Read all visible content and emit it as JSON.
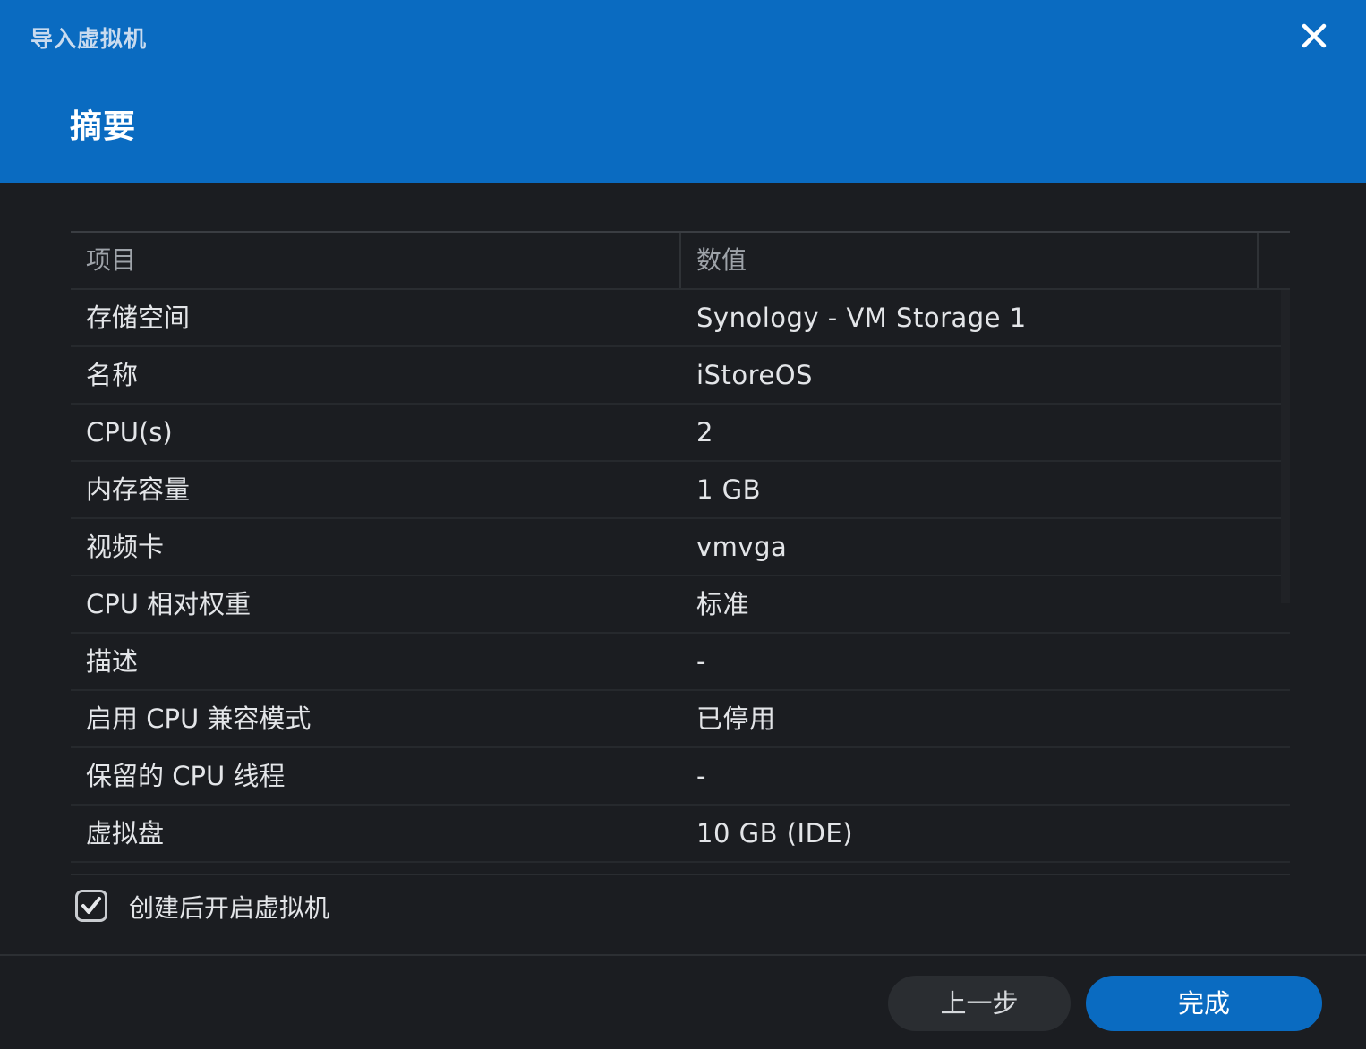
{
  "dialog": {
    "window_title": "导入虚拟机",
    "page_title": "摘要"
  },
  "table": {
    "headers": {
      "item": "项目",
      "value": "数值"
    },
    "rows": [
      {
        "item": "存储空间",
        "value": "Synology - VM Storage 1"
      },
      {
        "item": "名称",
        "value": "iStoreOS"
      },
      {
        "item": "CPU(s)",
        "value": "2"
      },
      {
        "item": "内存容量",
        "value": "1 GB"
      },
      {
        "item": "视频卡",
        "value": "vmvga"
      },
      {
        "item": "CPU 相对权重",
        "value": "标准"
      },
      {
        "item": "描述",
        "value": "-"
      },
      {
        "item": "启用 CPU 兼容模式",
        "value": "已停用"
      },
      {
        "item": "保留的 CPU 线程",
        "value": "-"
      },
      {
        "item": "虚拟盘",
        "value": "10 GB (IDE)"
      }
    ]
  },
  "power_on_after_create": {
    "label": "创建后开启虚拟机",
    "checked": true
  },
  "buttons": {
    "back": "上一步",
    "finish": "完成"
  },
  "colors": {
    "header_bg": "#0a6bc1",
    "body_bg": "#1b1d21",
    "primary_button": "#0a6bc1",
    "secondary_button": "#2a2d31"
  },
  "icons": {
    "close": "close-icon",
    "checkbox": "checkmark-icon"
  }
}
